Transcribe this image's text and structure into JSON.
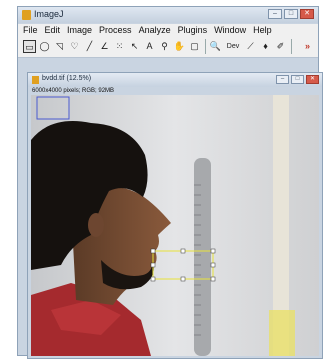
{
  "app": {
    "title": "ImageJ",
    "window_buttons": [
      "–",
      "□",
      "✕"
    ]
  },
  "menubar": [
    "File",
    "Edit",
    "Image",
    "Process",
    "Analyze",
    "Plugins",
    "Window",
    "Help"
  ],
  "toolbar": {
    "tools": [
      {
        "name": "rectangle-tool-icon",
        "glyph": "▭"
      },
      {
        "name": "oval-tool-icon",
        "glyph": "◯"
      },
      {
        "name": "polygon-tool-icon",
        "glyph": "◹"
      },
      {
        "name": "freehand-tool-icon",
        "glyph": "♡"
      },
      {
        "name": "line-tool-icon",
        "glyph": "╱"
      },
      {
        "name": "angle-tool-icon",
        "glyph": "∠"
      },
      {
        "name": "point-tool-icon",
        "glyph": "⁙"
      },
      {
        "name": "wand-tool-icon",
        "glyph": "↖"
      },
      {
        "name": "text-tool-icon",
        "glyph": "A"
      },
      {
        "name": "magnifier-tool-icon",
        "glyph": "⚲"
      },
      {
        "name": "hand-tool-icon",
        "glyph": "✋"
      },
      {
        "name": "color-picker-tool-icon",
        "glyph": "▢"
      },
      {
        "name": "zoom-tool-icon",
        "glyph": "🔍"
      },
      {
        "name": "developer-menu-icon",
        "glyph": "Dev"
      },
      {
        "name": "stacks-menu-icon",
        "glyph": "⟋"
      },
      {
        "name": "brush-tool-icon",
        "glyph": "♦"
      },
      {
        "name": "flood-fill-tool-icon",
        "glyph": "✐"
      },
      {
        "name": "more-tools-icon",
        "glyph": "»"
      }
    ]
  },
  "image_window": {
    "title": "bvdd.tif (12.5%)",
    "info": "6000x4000 pixels; RGB; 92MB",
    "window_buttons": [
      "–",
      "□",
      "✕"
    ]
  }
}
